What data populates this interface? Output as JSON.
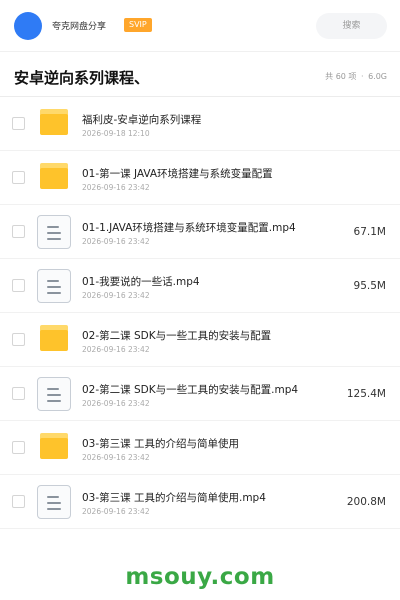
{
  "header": {
    "user_name": "夸克网盘分享",
    "badge": "SVIP",
    "search_placeholder": "搜索"
  },
  "folder": {
    "title": "安卓逆向系列课程、",
    "count": "共 60 项",
    "separator": "·",
    "size": "6.0G"
  },
  "items": [
    {
      "type": "folder",
      "name": "福利皮-安卓逆向系列课程",
      "date": "2026-09-18 12:10",
      "size": ""
    },
    {
      "type": "folder",
      "name": "01-第一课 JAVA环境搭建与系统变量配置",
      "date": "2026-09-16 23:42",
      "size": ""
    },
    {
      "type": "file",
      "name": "01-1.JAVA环境搭建与系统环境变量配置.mp4",
      "date": "2026-09-16 23:42",
      "size": "67.1M"
    },
    {
      "type": "file",
      "name": "01-我要说的一些话.mp4",
      "date": "2026-09-16 23:42",
      "size": "95.5M"
    },
    {
      "type": "folder",
      "name": "02-第二课 SDK与一些工具的安装与配置",
      "date": "2026-09-16 23:42",
      "size": ""
    },
    {
      "type": "file",
      "name": "02-第二课 SDK与一些工具的安装与配置.mp4",
      "date": "2026-09-16 23:42",
      "size": "125.4M"
    },
    {
      "type": "folder",
      "name": "03-第三课 工具的介绍与简单使用",
      "date": "2026-09-16 23:42",
      "size": ""
    },
    {
      "type": "file",
      "name": "03-第三课 工具的介绍与简单使用.mp4",
      "date": "2026-09-16 23:42",
      "size": "200.8M"
    }
  ],
  "watermark": "msouy.com",
  "colors": {
    "avatar": "#2f7bf5",
    "badge": "#ffa62b",
    "folder_icon": "#fec32b",
    "watermark": "#3aa845"
  }
}
